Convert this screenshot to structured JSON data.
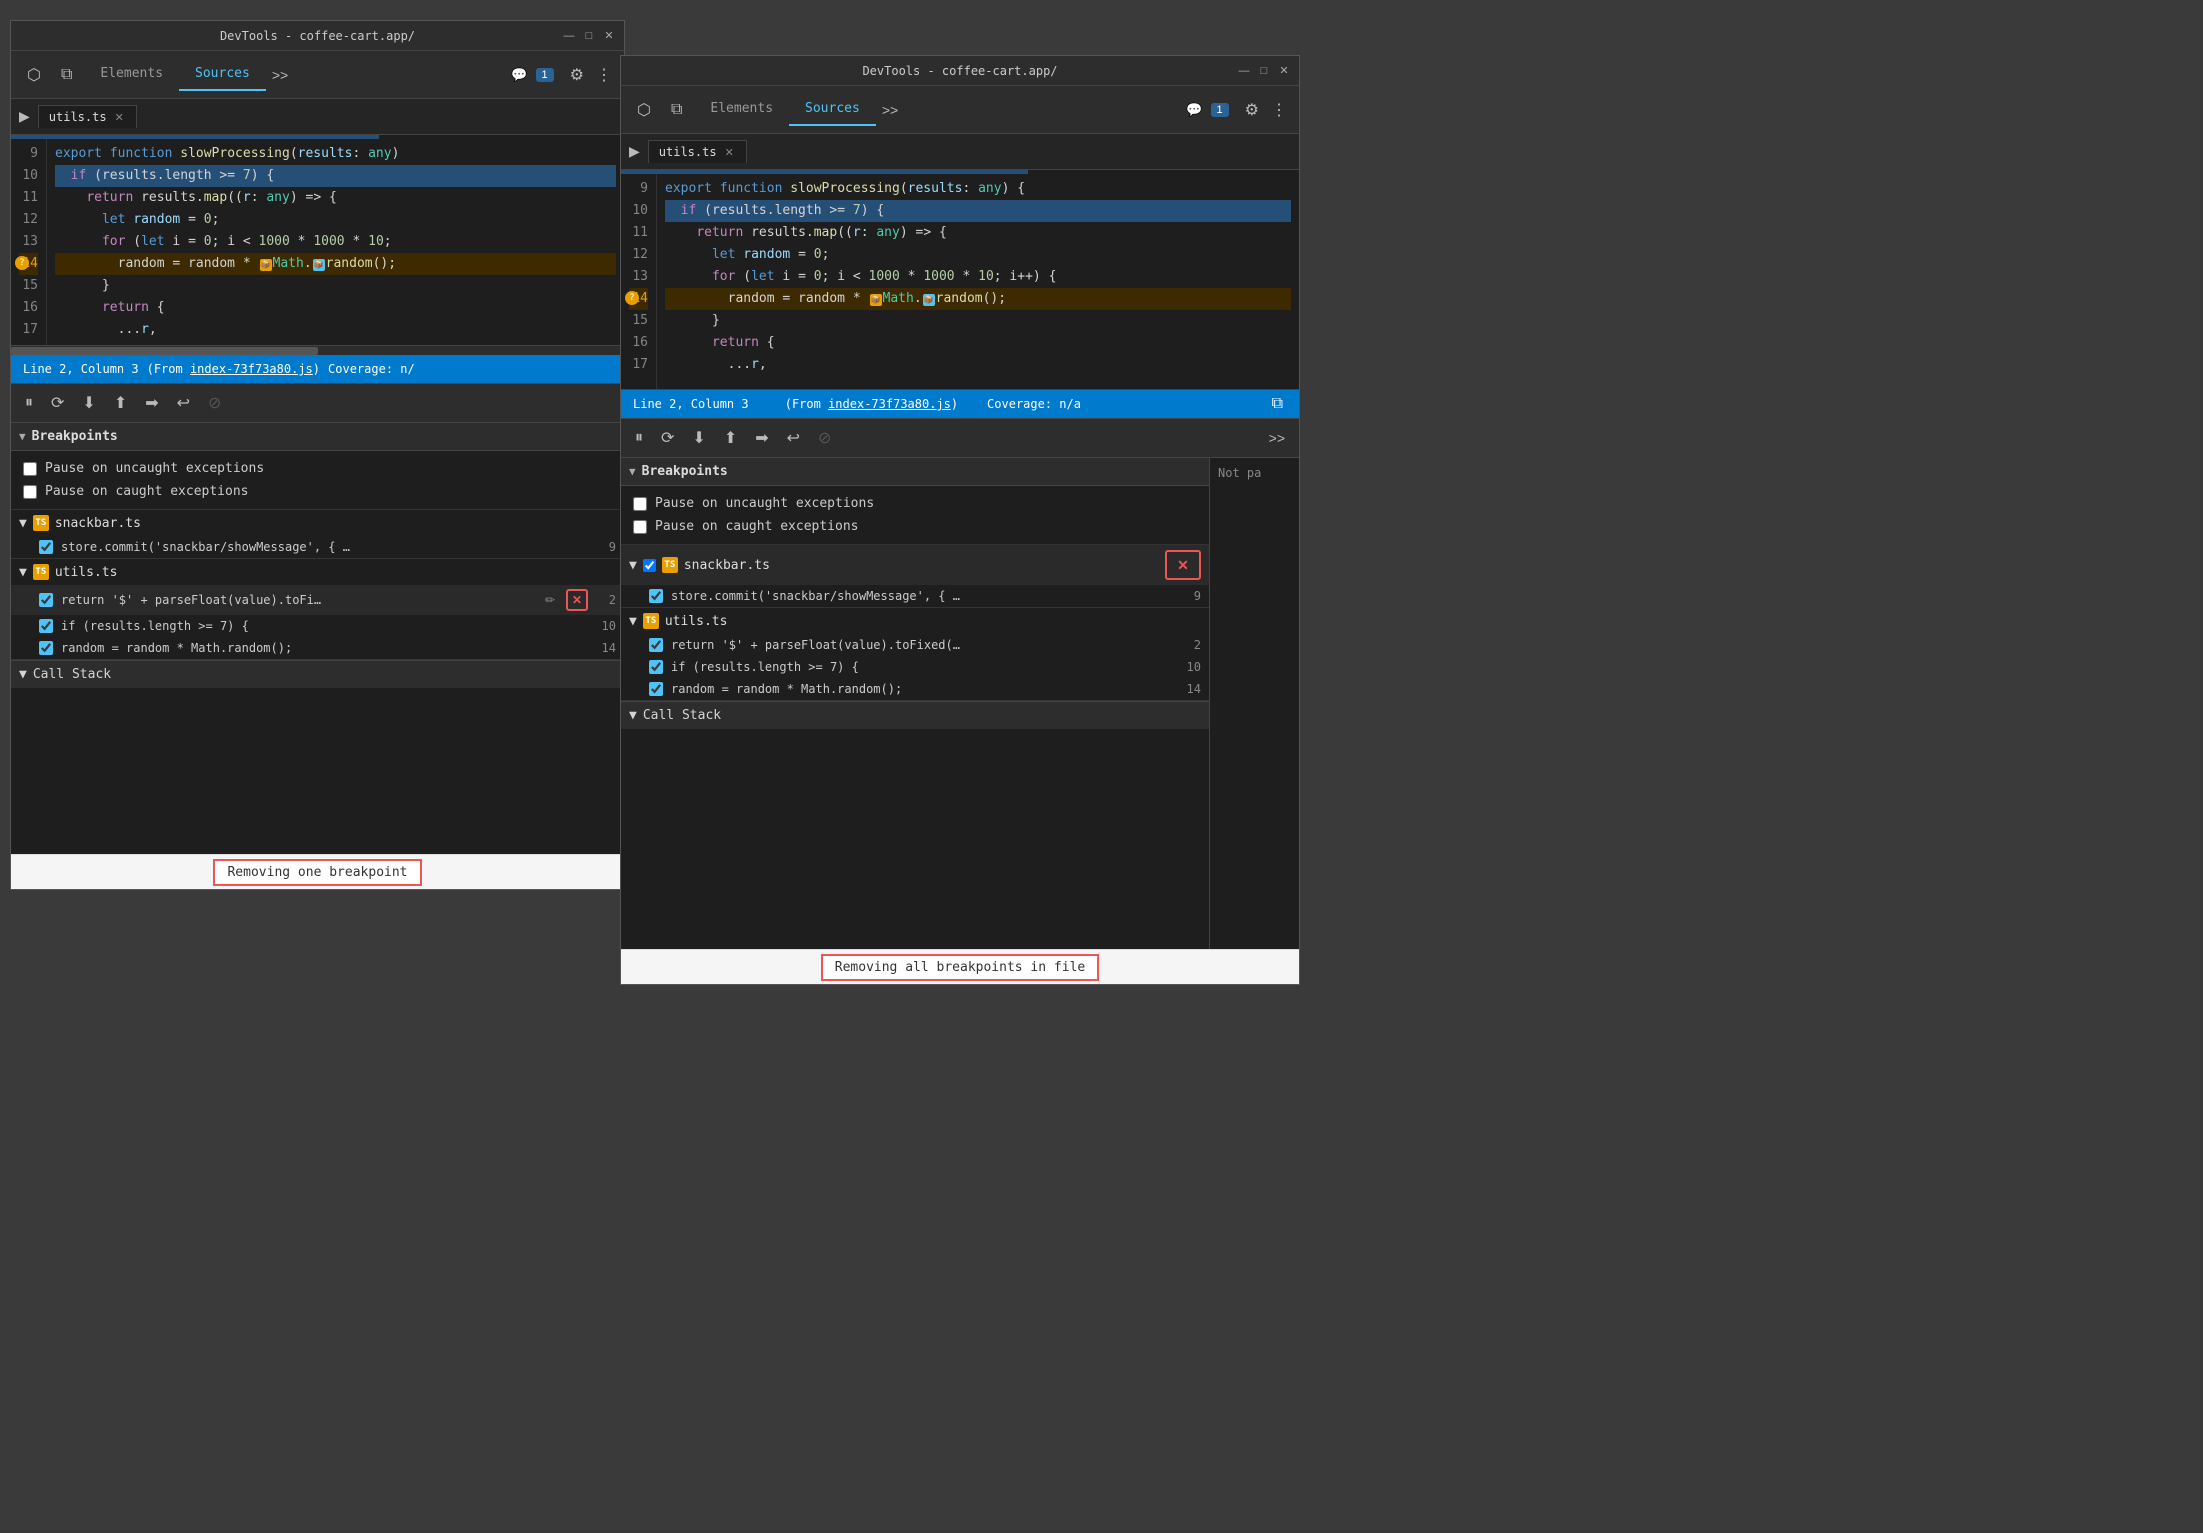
{
  "left_window": {
    "title": "DevTools - coffee-cart.app/",
    "titlebar_controls": [
      "—",
      "□",
      "✕"
    ],
    "tabs": [
      {
        "label": "Elements",
        "active": false
      },
      {
        "label": "Sources",
        "active": true
      },
      {
        "label": ">>",
        "active": false
      }
    ],
    "badge": "1",
    "file_tab": "utils.ts",
    "code": {
      "lines": [
        {
          "num": "9",
          "text": "export function slowProcessing(results: any)",
          "highlight": false,
          "breakpoint": false
        },
        {
          "num": "10",
          "text": "  if (results.length >= 7) {",
          "highlight": true,
          "breakpoint": false
        },
        {
          "num": "11",
          "text": "    return results.map((r: any) => {",
          "highlight": false,
          "breakpoint": false
        },
        {
          "num": "12",
          "text": "      let random = 0;",
          "highlight": false,
          "breakpoint": false
        },
        {
          "num": "13",
          "text": "      for (let i = 0; i < 1000 * 1000 * 10;",
          "highlight": false,
          "breakpoint": false
        },
        {
          "num": "14",
          "text": "        random = random * 📦Math.📦random();",
          "highlight": false,
          "breakpoint": true
        },
        {
          "num": "15",
          "text": "      }",
          "highlight": false,
          "breakpoint": false
        },
        {
          "num": "16",
          "text": "      return {",
          "highlight": false,
          "breakpoint": false
        },
        {
          "num": "17",
          "text": "        ...r,",
          "highlight": false,
          "breakpoint": false
        }
      ]
    },
    "status": {
      "line_col": "Line 2, Column 3",
      "from": "(From index-73f73a80.js)",
      "link": "index-73f73a80.js",
      "coverage": "Coverage: n/"
    },
    "debug_toolbar": {
      "buttons": [
        "⏸",
        "⟳",
        "⬇",
        "⬆",
        "➡",
        "↩"
      ]
    },
    "breakpoints_section": "Breakpoints",
    "pause_uncaught": "Pause on uncaught exceptions",
    "pause_caught": "Pause on caught exceptions",
    "bp_files": [
      {
        "name": "snackbar.ts",
        "items": [
          {
            "text": "store.commit('snackbar/showMessage', { …",
            "line": "9"
          }
        ]
      },
      {
        "name": "utils.ts",
        "items": [
          {
            "text": "return '$' + parseFloat(value).toFi…",
            "line": "2",
            "has_delete": true
          },
          {
            "text": "if (results.length >= 7) {",
            "line": "10"
          },
          {
            "text": "random = random * Math.random();",
            "line": "14"
          }
        ]
      }
    ],
    "call_stack_section": "Call Stack",
    "label_bottom": "Removing one breakpoint"
  },
  "right_window": {
    "title": "DevTools - coffee-cart.app/",
    "titlebar_controls": [
      "—",
      "□",
      "✕"
    ],
    "tabs": [
      {
        "label": "Elements",
        "active": false
      },
      {
        "label": "Sources",
        "active": true
      },
      {
        "label": ">>",
        "active": false
      }
    ],
    "badge": "1",
    "file_tab": "utils.ts",
    "code": {
      "lines": [
        {
          "num": "9",
          "text": "export function slowProcessing(results: any) {",
          "highlight": false,
          "breakpoint": false
        },
        {
          "num": "10",
          "text": "  if (results.length >= 7) {",
          "highlight": true,
          "breakpoint": false
        },
        {
          "num": "11",
          "text": "    return results.map((r: any) => {",
          "highlight": false,
          "breakpoint": false
        },
        {
          "num": "12",
          "text": "      let random = 0;",
          "highlight": false,
          "breakpoint": false
        },
        {
          "num": "13",
          "text": "      for (let i = 0; i < 1000 * 1000 * 10; i++) {",
          "highlight": false,
          "breakpoint": false
        },
        {
          "num": "14",
          "text": "        random = random * 📦Math.📦random();",
          "highlight": false,
          "breakpoint": true
        },
        {
          "num": "15",
          "text": "      }",
          "highlight": false,
          "breakpoint": false
        },
        {
          "num": "16",
          "text": "      return {",
          "highlight": false,
          "breakpoint": false
        },
        {
          "num": "17",
          "text": "        ...r,",
          "highlight": false,
          "breakpoint": false
        }
      ]
    },
    "status": {
      "line_col": "Line 2, Column 3",
      "from": "(From index-73f73a80.js)",
      "link": "index-73f73a80.js",
      "coverage": "Coverage: n/a"
    },
    "breakpoints_section": "Breakpoints",
    "pause_uncaught": "Pause on uncaught exceptions",
    "pause_caught": "Pause on caught exceptions",
    "bp_files": [
      {
        "name": "snackbar.ts",
        "has_delete_all": true,
        "items": [
          {
            "text": "store.commit('snackbar/showMessage', { …",
            "line": "9"
          }
        ]
      },
      {
        "name": "utils.ts",
        "items": [
          {
            "text": "return '$' + parseFloat(value).toFixed(…",
            "line": "2"
          },
          {
            "text": "if (results.length >= 7) {",
            "line": "10"
          },
          {
            "text": "random = random * Math.random();",
            "line": "14"
          }
        ]
      }
    ],
    "call_stack_section": "Call Stack",
    "not_paused": "Not pa",
    "label_bottom": "Removing all breakpoints in file"
  },
  "icons": {
    "cursor": "⬡",
    "layers": "⧉",
    "settings": "⚙",
    "more": "⋮",
    "file-toggle": "▶",
    "close": "✕",
    "pause": "⏸",
    "step-over": "⤼",
    "step-into": "⬇",
    "step-out": "⬆",
    "resume": "▶",
    "deactivate": "⊘",
    "collapse-arrow": "▼",
    "ts-icon": "TS"
  }
}
